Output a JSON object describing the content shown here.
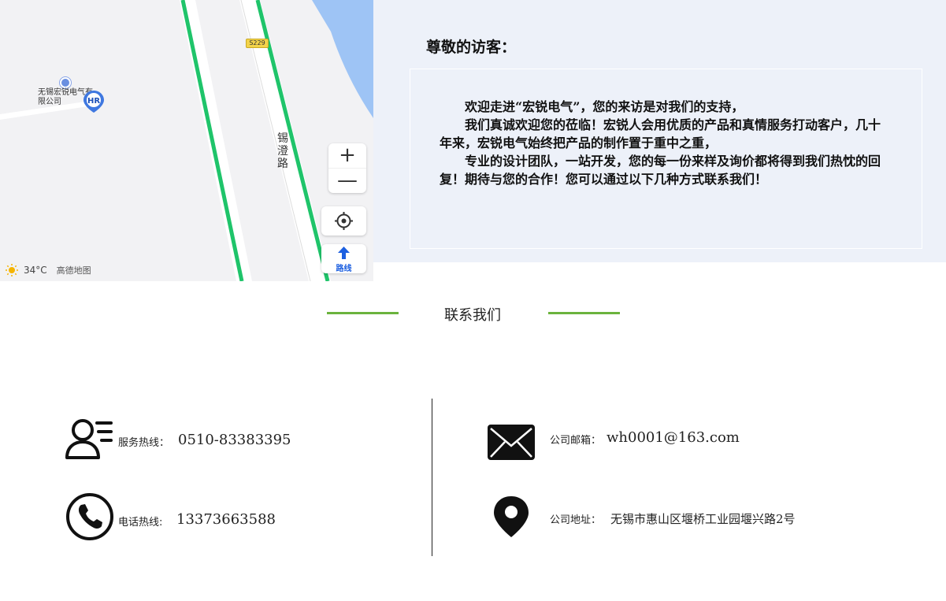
{
  "map": {
    "road_name": "锡澄路",
    "highway_badge": "S229",
    "poi_label": "无锡宏锐电气有限公司",
    "weather_temp": "34°C",
    "brand": "高德地图",
    "zoom_in_label": "+",
    "zoom_out_label": "—",
    "route_label": "路线"
  },
  "visitor": {
    "title": "尊敬的访客：",
    "paragraphs": [
      "欢迎走进“宏锐电气”，您的来访是对我们的支持，",
      "我们真诚欢迎您的莅临！宏锐人会用优质的产品和真情服务打动客户，几十年来，宏锐电气始终把产品的制作置于重中之重，",
      "专业的设计团队，一站开发，您的每一份来样及询价都将得到我们热忱的回复！期待与您的合作！您可以通过以下几种方式联系我们！"
    ]
  },
  "section": {
    "title": "联系我们",
    "accent_color": "#6bb33d"
  },
  "contacts": {
    "service": {
      "label": "服务热线：",
      "value": "0510-83383395"
    },
    "phone": {
      "label": "电话热线:",
      "value": "13373663588"
    },
    "email": {
      "label": "公司邮箱：",
      "value": "wh0001@163.com"
    },
    "address": {
      "label": "公司地址：",
      "value": "无锡市惠山区堰桥工业园堰兴路2号"
    }
  }
}
